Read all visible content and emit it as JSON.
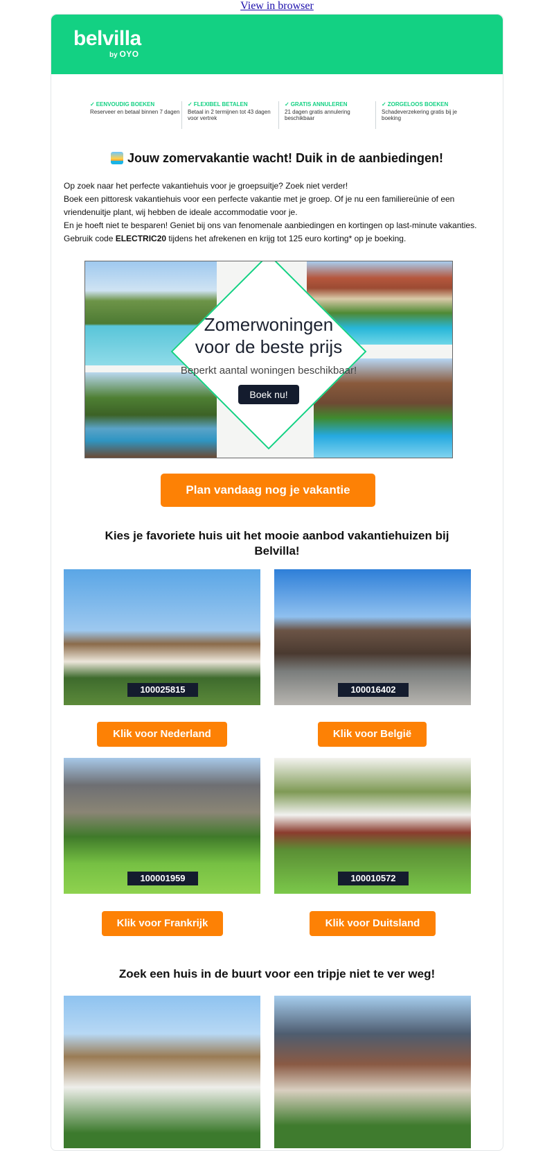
{
  "top_link": {
    "label": "View in browser"
  },
  "brand": {
    "name": "belvilla",
    "by": "by",
    "partner": "OYO"
  },
  "usps": [
    {
      "title": "EENVOUDIG BOEKEN",
      "text": "Reserveer en betaal binnen 7 dagen"
    },
    {
      "title": "FLEXIBEL BETALEN",
      "text": "Betaal in 2 termijnen tot 43 dagen voor vertrek"
    },
    {
      "title": "GRATIS ANNULEREN",
      "text": "21 dagen gratis annulering beschikbaar"
    },
    {
      "title": "ZORGELOOS BOEKEN",
      "text": "Schadeverzekering gratis bij je boeking"
    }
  ],
  "intro": {
    "title": "Jouw zomervakantie wacht! Duik in de aanbiedingen!",
    "p1": "Op zoek naar het perfecte vakantiehuis voor je groepsuitje? Zoek niet verder!",
    "p2": "Boek een pittoresk vakantiehuis voor een perfecte vakantie met je groep. Of je nu een familiereünie of een vriendenuitje plant, wij hebben de ideale accommodatie voor je.",
    "p3": "En je hoeft niet te besparen! Geniet bij ons van fenomenale aanbiedingen en kortingen op last-minute vakanties.",
    "p4_before": "Gebruik code ",
    "p4_code": "ELECTRIC20",
    "p4_after": " tijdens het afrekenen en krijg tot 125 euro korting* op je boeking."
  },
  "banner": {
    "line1": "Zomerwoningen",
    "line2": "voor de beste prijs",
    "subtitle": "Beperkt aantal woningen beschikbaar!",
    "button": "Boek nu!"
  },
  "cta": {
    "label": "Plan vandaag nog je vakantie"
  },
  "choose": {
    "title": "Kies je favoriete huis uit het mooie aanbod vakantiehuizen bij Belvilla!"
  },
  "houses": [
    {
      "id": "100025815",
      "button": "Klik voor Nederland"
    },
    {
      "id": "100016402",
      "button": "Klik voor België"
    },
    {
      "id": "100001959",
      "button": "Klik voor Frankrijk"
    },
    {
      "id": "100010572",
      "button": "Klik voor Duitsland"
    }
  ],
  "nearby": {
    "title": "Zoek een huis in de buurt voor een tripje niet te ver weg!"
  },
  "colors": {
    "brand_green": "#13d183",
    "cta_orange": "#fd8105",
    "navy": "#141c2e"
  }
}
